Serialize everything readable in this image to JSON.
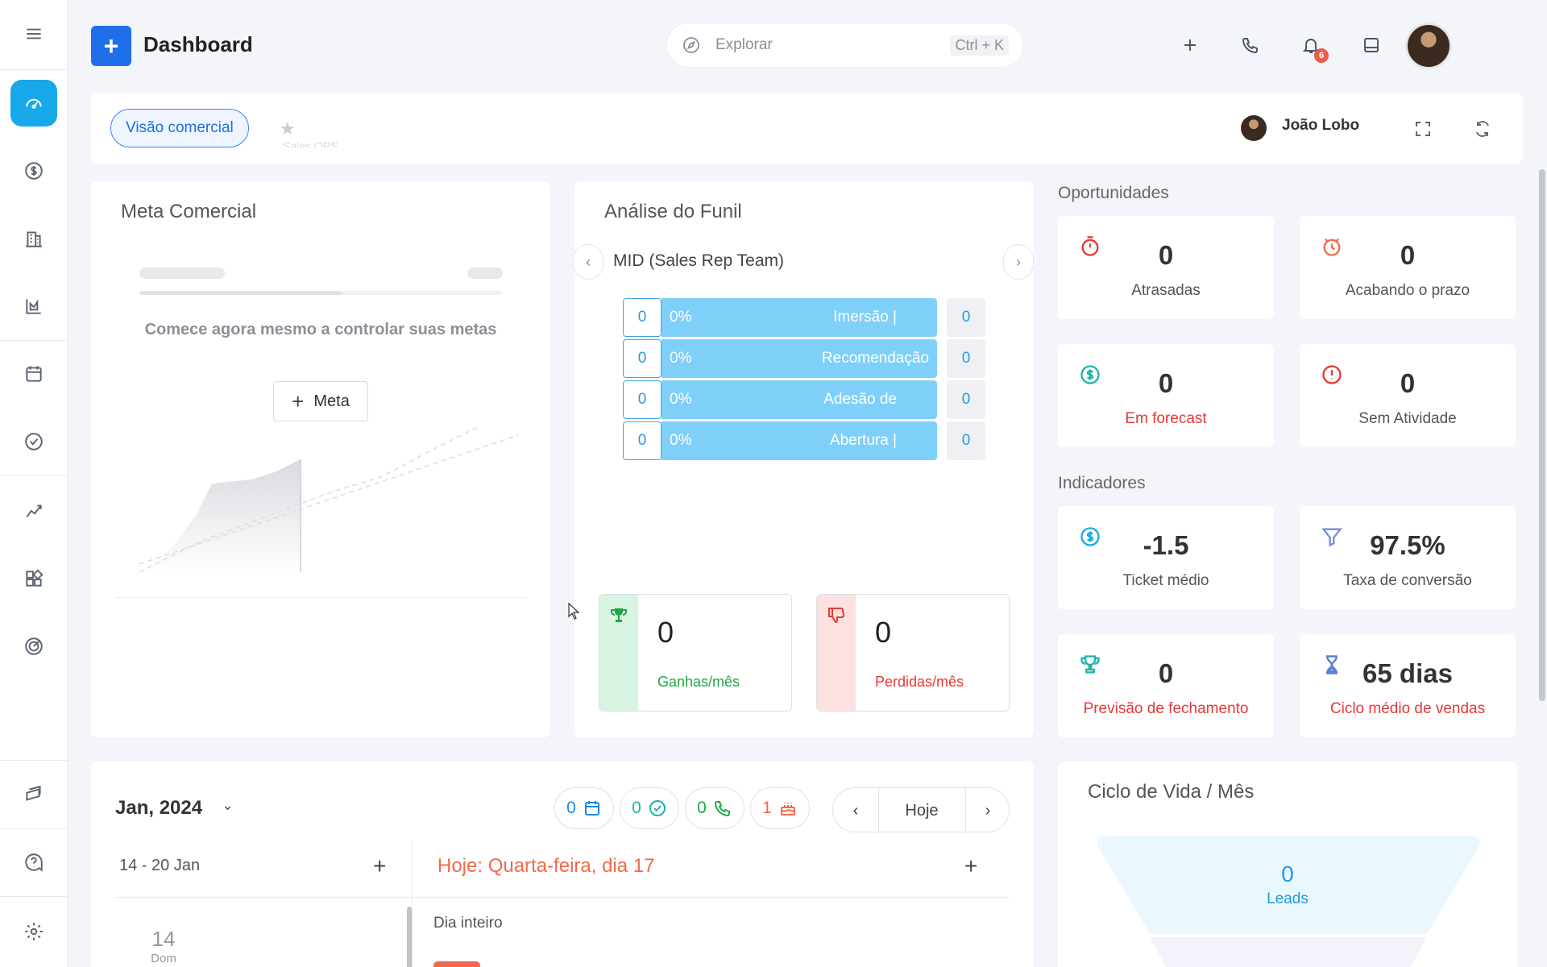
{
  "header": {
    "title": "Dashboard",
    "logo_symbol": "+",
    "search_placeholder": "Explorar",
    "search_shortcut": "Ctrl + K",
    "notification_count": "6"
  },
  "sidebar": {
    "items": [
      {
        "name": "menu-icon"
      },
      {
        "name": "dashboard-icon",
        "active": true
      },
      {
        "name": "dollar-icon"
      },
      {
        "name": "building-icon"
      },
      {
        "name": "chart-icon"
      },
      {
        "name": "calendar-icon"
      },
      {
        "name": "check-icon"
      },
      {
        "name": "trend-icon"
      },
      {
        "name": "widgets-icon"
      },
      {
        "name": "target-icon"
      },
      {
        "name": "layers-icon"
      },
      {
        "name": "help-icon"
      },
      {
        "name": "gear-icon"
      }
    ]
  },
  "filterbar": {
    "chip_label": "Visão comercial",
    "faded_text": "Sales OPS",
    "user_name": "João Lobo"
  },
  "meta": {
    "title": "Meta Comercial",
    "message": "Comece agora mesmo a controlar suas metas",
    "button_label": "Meta"
  },
  "funnel": {
    "title": "Análise do Funil",
    "team": "MID (Sales Rep Team)",
    "stages": [
      {
        "count": "0",
        "pct": "0%",
        "label": "Imersão |",
        "right": "0"
      },
      {
        "count": "0",
        "pct": "0%",
        "label": "Recomendação",
        "right": "0"
      },
      {
        "count": "0",
        "pct": "0%",
        "label": "Adesão de",
        "right": "0"
      },
      {
        "count": "0",
        "pct": "0%",
        "label": "Abertura |",
        "right": "0"
      }
    ],
    "won": {
      "value": "0",
      "label": "Ganhas/mês"
    },
    "lost": {
      "value": "0",
      "label": "Perdidas/mês"
    }
  },
  "opportunities": {
    "title": "Oportunidades",
    "items": [
      {
        "value": "0",
        "label": "Atrasadas"
      },
      {
        "value": "0",
        "label": "Acabando o prazo"
      },
      {
        "value": "0",
        "label": "Em forecast"
      },
      {
        "value": "0",
        "label": "Sem Atividade"
      }
    ]
  },
  "indicators": {
    "title": "Indicadores",
    "items": [
      {
        "value": "-1.5",
        "label": "Ticket médio"
      },
      {
        "value": "97.5%",
        "label": "Taxa de conversão"
      },
      {
        "value": "0",
        "label": "Previsão de fechamento"
      },
      {
        "value": "65 dias",
        "label": "Ciclo médio de vendas"
      }
    ]
  },
  "calendar": {
    "month": "Jan, 2024",
    "counters": {
      "events": "0",
      "tasks": "0",
      "calls": "0",
      "birthdays": "1"
    },
    "today_button": "Hoje",
    "range": "14 - 20 Jan",
    "today_label": "Hoje: Quarta-feira, dia 17",
    "all_day": "Dia inteiro",
    "day_number": "14",
    "day_name": "Dom"
  },
  "lifecycle": {
    "title": "Ciclo de Vida / Mês",
    "value": "0",
    "label": "Leads"
  },
  "colors": {
    "primary": "#1f6feb",
    "accent": "#16a8e8",
    "funnel_bar": "#7ed0f8",
    "danger": "#e53935",
    "success": "#22a447",
    "orange": "#f06a4a"
  }
}
